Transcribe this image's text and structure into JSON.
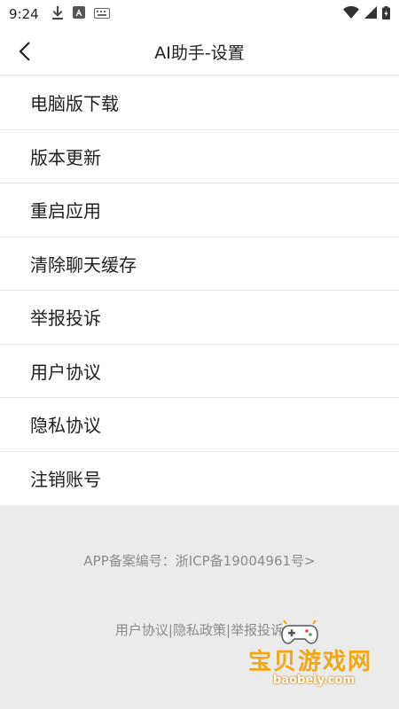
{
  "status_bar": {
    "time": "9:24",
    "icons_left": [
      "download-icon",
      "a-app-icon",
      "keyboard-icon"
    ],
    "icons_right": [
      "wifi-icon",
      "signal-icon",
      "battery-icon"
    ]
  },
  "header": {
    "title": "AI助手-设置",
    "back_icon": "chevron-left-icon"
  },
  "menu": {
    "items": [
      {
        "label": "电脑版下载"
      },
      {
        "label": "版本更新"
      },
      {
        "label": "重启应用"
      },
      {
        "label": "清除聊天缓存"
      },
      {
        "label": "举报投诉"
      },
      {
        "label": "用户协议"
      },
      {
        "label": "隐私协议"
      },
      {
        "label": "注销账号"
      }
    ]
  },
  "footer": {
    "icp": "APP备案编号：浙ICP备19004961号>",
    "links": [
      "用户协议",
      "隐私政策",
      "举报投诉"
    ],
    "separator": "|"
  },
  "watermark": {
    "text": "宝贝游戏网",
    "url": "baobeiy.com",
    "icon": "gamepad-icon"
  },
  "colors": {
    "background": "#ebebeb",
    "surface": "#ffffff",
    "muted_text": "#8c8c8c",
    "watermark": "#f2a814"
  }
}
